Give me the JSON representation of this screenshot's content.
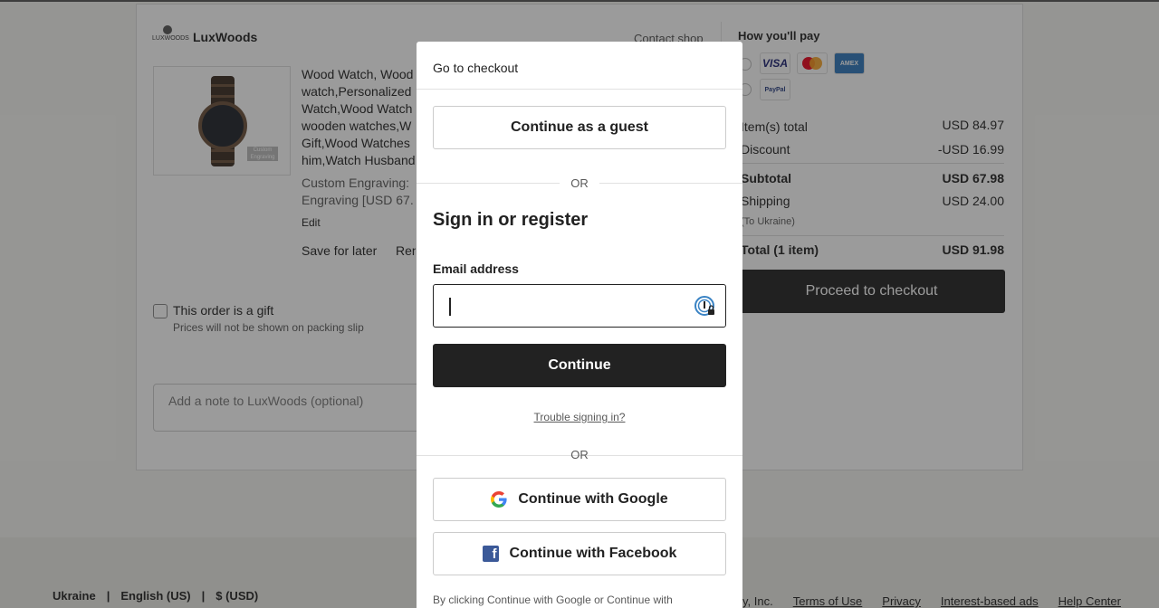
{
  "shop": {
    "logo_text": "LUXWOODS",
    "name": "LuxWoods",
    "contact_label": "Contact shop"
  },
  "product": {
    "title_lines": [
      "Wood Watch, Wood",
      "watch,Personalized",
      "Watch,Wood Watch",
      "wooden watches,W",
      "Gift,Wood Watches",
      "him,Watch Husband"
    ],
    "custom_lines": [
      "Custom Engraving:",
      "Engraving [USD 67."
    ],
    "engrave_tag": "Custom Engraving",
    "edit_label": "Edit",
    "save_label": "Save for later",
    "remove_label": "Remove"
  },
  "gift": {
    "label": "This order is a gift",
    "sub": "Prices will not be shown on packing slip"
  },
  "note": {
    "placeholder": "Add a note to LuxWoods (optional)"
  },
  "payment": {
    "title": "How you'll pay",
    "cards": [
      "VISA",
      "mastercard",
      "AMERICAN EXPRESS",
      "PayPal"
    ]
  },
  "summary": {
    "items_total_label": "Item(s) total",
    "items_total": "USD 84.97",
    "discount_label": "Discount",
    "discount": "-USD 16.99",
    "subtotal_label": "Subtotal",
    "subtotal": "USD 67.98",
    "shipping_label": "Shipping",
    "shipping": "USD 24.00",
    "shipping_sub": "(To Ukraine)",
    "total_label": "Total (1 item)",
    "total": "USD 91.98",
    "checkout_label": "Proceed to checkout"
  },
  "footer": {
    "region": "Ukraine",
    "language": "English (US)",
    "currency": "$ (USD)",
    "sep": "|",
    "links": [
      "y, Inc.",
      "Terms of Use",
      "Privacy",
      "Interest-based ads",
      "Help Center"
    ]
  },
  "modal": {
    "title": "Go to checkout",
    "guest_label": "Continue as a guest",
    "or_label": "OR",
    "signin_title": "Sign in or register",
    "email_label": "Email address",
    "email_value": "",
    "continue_label": "Continue",
    "trouble_label": "Trouble signing in?",
    "google_label": "Continue with Google",
    "facebook_label": "Continue with Facebook",
    "legal": "By clicking Continue with Google or Continue with"
  },
  "colors": {
    "primary_button": "#222222",
    "overlay": "rgba(34,34,34,0.45)",
    "facebook": "#3b5998"
  }
}
